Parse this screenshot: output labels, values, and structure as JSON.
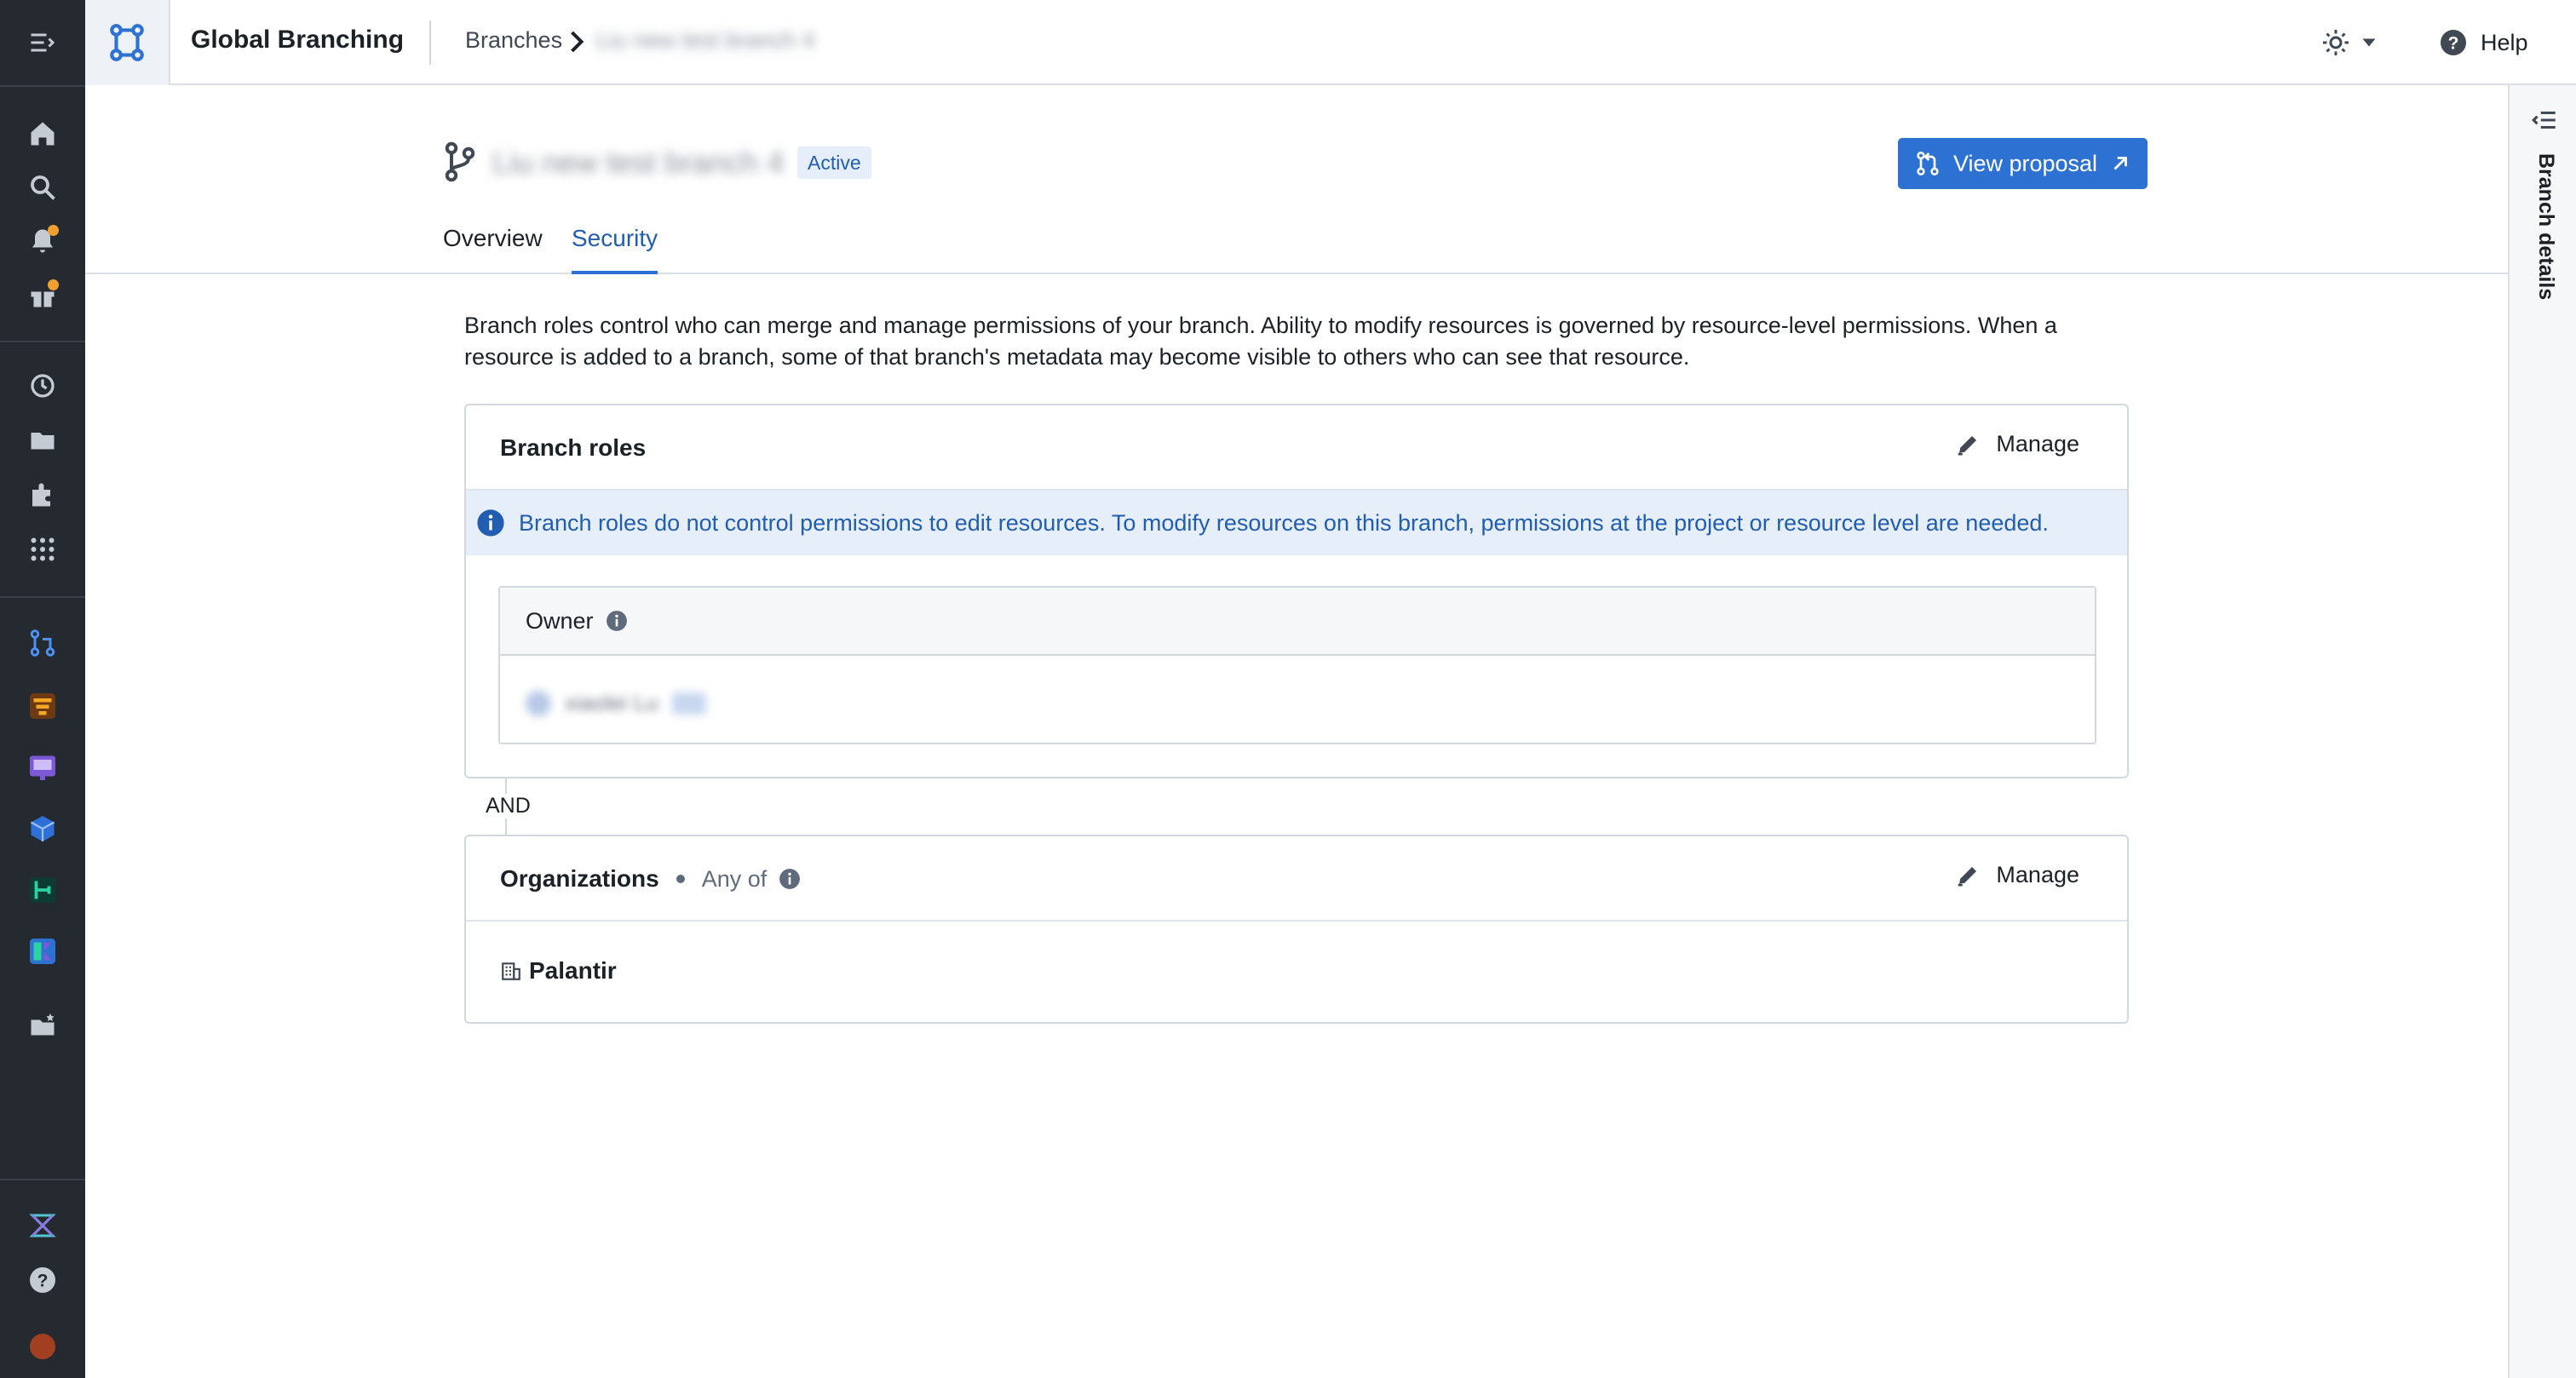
{
  "app": {
    "title": "Global Branching",
    "icon": "git-branch-network-icon"
  },
  "breadcrumb": {
    "root": "Branches",
    "current": "Liu new test branch 4"
  },
  "topbar": {
    "theme_icon": "sun-icon",
    "help_label": "Help"
  },
  "branch": {
    "name": "Liu new test branch 4",
    "status": "Active",
    "view_proposal_label": "View proposal"
  },
  "tabs": [
    {
      "label": "Overview",
      "active": false
    },
    {
      "label": "Security",
      "active": true
    }
  ],
  "description": "Branch roles control who can merge and manage permissions of your branch. Ability to modify resources is governed by resource-level permissions. When a resource is added to a branch, some of that branch's metadata may become visible to others who can see that resource.",
  "branch_roles": {
    "title": "Branch roles",
    "manage_label": "Manage",
    "callout": "Branch roles do not control permissions to edit resources. To modify resources on this branch, permissions at the project or resource level are needed.",
    "owner_label": "Owner",
    "owner_user": "xiaolei Lu"
  },
  "and_label": "AND",
  "organizations": {
    "title": "Organizations",
    "mode": "Any of",
    "manage_label": "Manage",
    "items": [
      "Palantir"
    ]
  },
  "right_panel": {
    "label": "Branch details"
  },
  "colors": {
    "primary": "#2d72d2",
    "primary_text": "#215db0",
    "rail_bg": "#252a31",
    "callout_bg": "#e6eef9",
    "notification_dot": "#f0a030"
  },
  "rail_icons": [
    "menu-expand-icon",
    "home-icon",
    "search-icon",
    "notifications-icon",
    "gift-icon",
    "history-icon",
    "folder-icon",
    "puzzle-icon",
    "apps-grid-icon",
    "branching-icon",
    "app-orange-icon",
    "app-purple-icon",
    "app-cube-icon",
    "app-green-icon",
    "app-colorful-icon",
    "folder-star-icon",
    "network-icon",
    "help-icon",
    "account-avatar-icon"
  ]
}
